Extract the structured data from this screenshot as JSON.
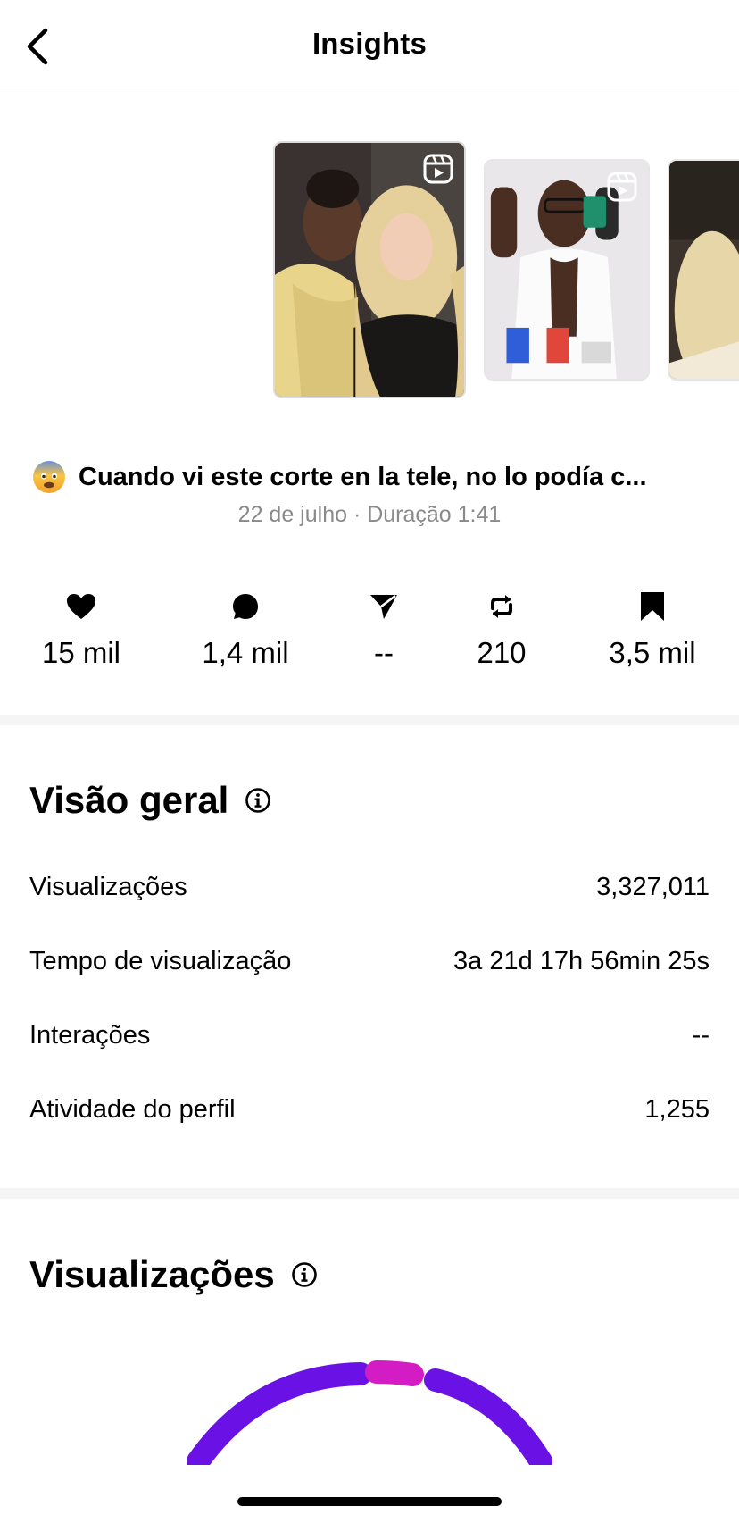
{
  "header": {
    "title": "Insights",
    "back_icon": "chevron-left-icon"
  },
  "thumbnails": [
    {
      "name": "reel-thumbnail-1",
      "icon": "reels-icon"
    },
    {
      "name": "reel-thumbnail-2",
      "icon": "reels-icon"
    },
    {
      "name": "reel-thumbnail-3"
    }
  ],
  "post": {
    "caption": "Cuando vi este corte en la tele, no lo podía c...",
    "emoji": "fearful-face-emoji",
    "meta": "22 de julho · Duração 1:41"
  },
  "stats": [
    {
      "icon": "heart-icon",
      "value": "15 mil"
    },
    {
      "icon": "comment-icon",
      "value": "1,4 mil"
    },
    {
      "icon": "share-icon",
      "value": "--"
    },
    {
      "icon": "repost-icon",
      "value": "210"
    },
    {
      "icon": "bookmark-icon",
      "value": "3,5 mil"
    }
  ],
  "overview": {
    "title": "Visão geral",
    "rows": [
      {
        "label": "Visualizações",
        "value": "3,327,011"
      },
      {
        "label": "Tempo de visualização",
        "value": "3a 21d 17h 56min 25s"
      },
      {
        "label": "Interações",
        "value": "--"
      },
      {
        "label": "Atividade do perfil",
        "value": "1,255"
      }
    ]
  },
  "views": {
    "title": "Visualizações"
  },
  "colors": {
    "gauge_primary": "#6a12e6",
    "gauge_accent": "#d41cc4",
    "divider": "#f5f5f5",
    "secondary_text": "#8a8a8a"
  }
}
